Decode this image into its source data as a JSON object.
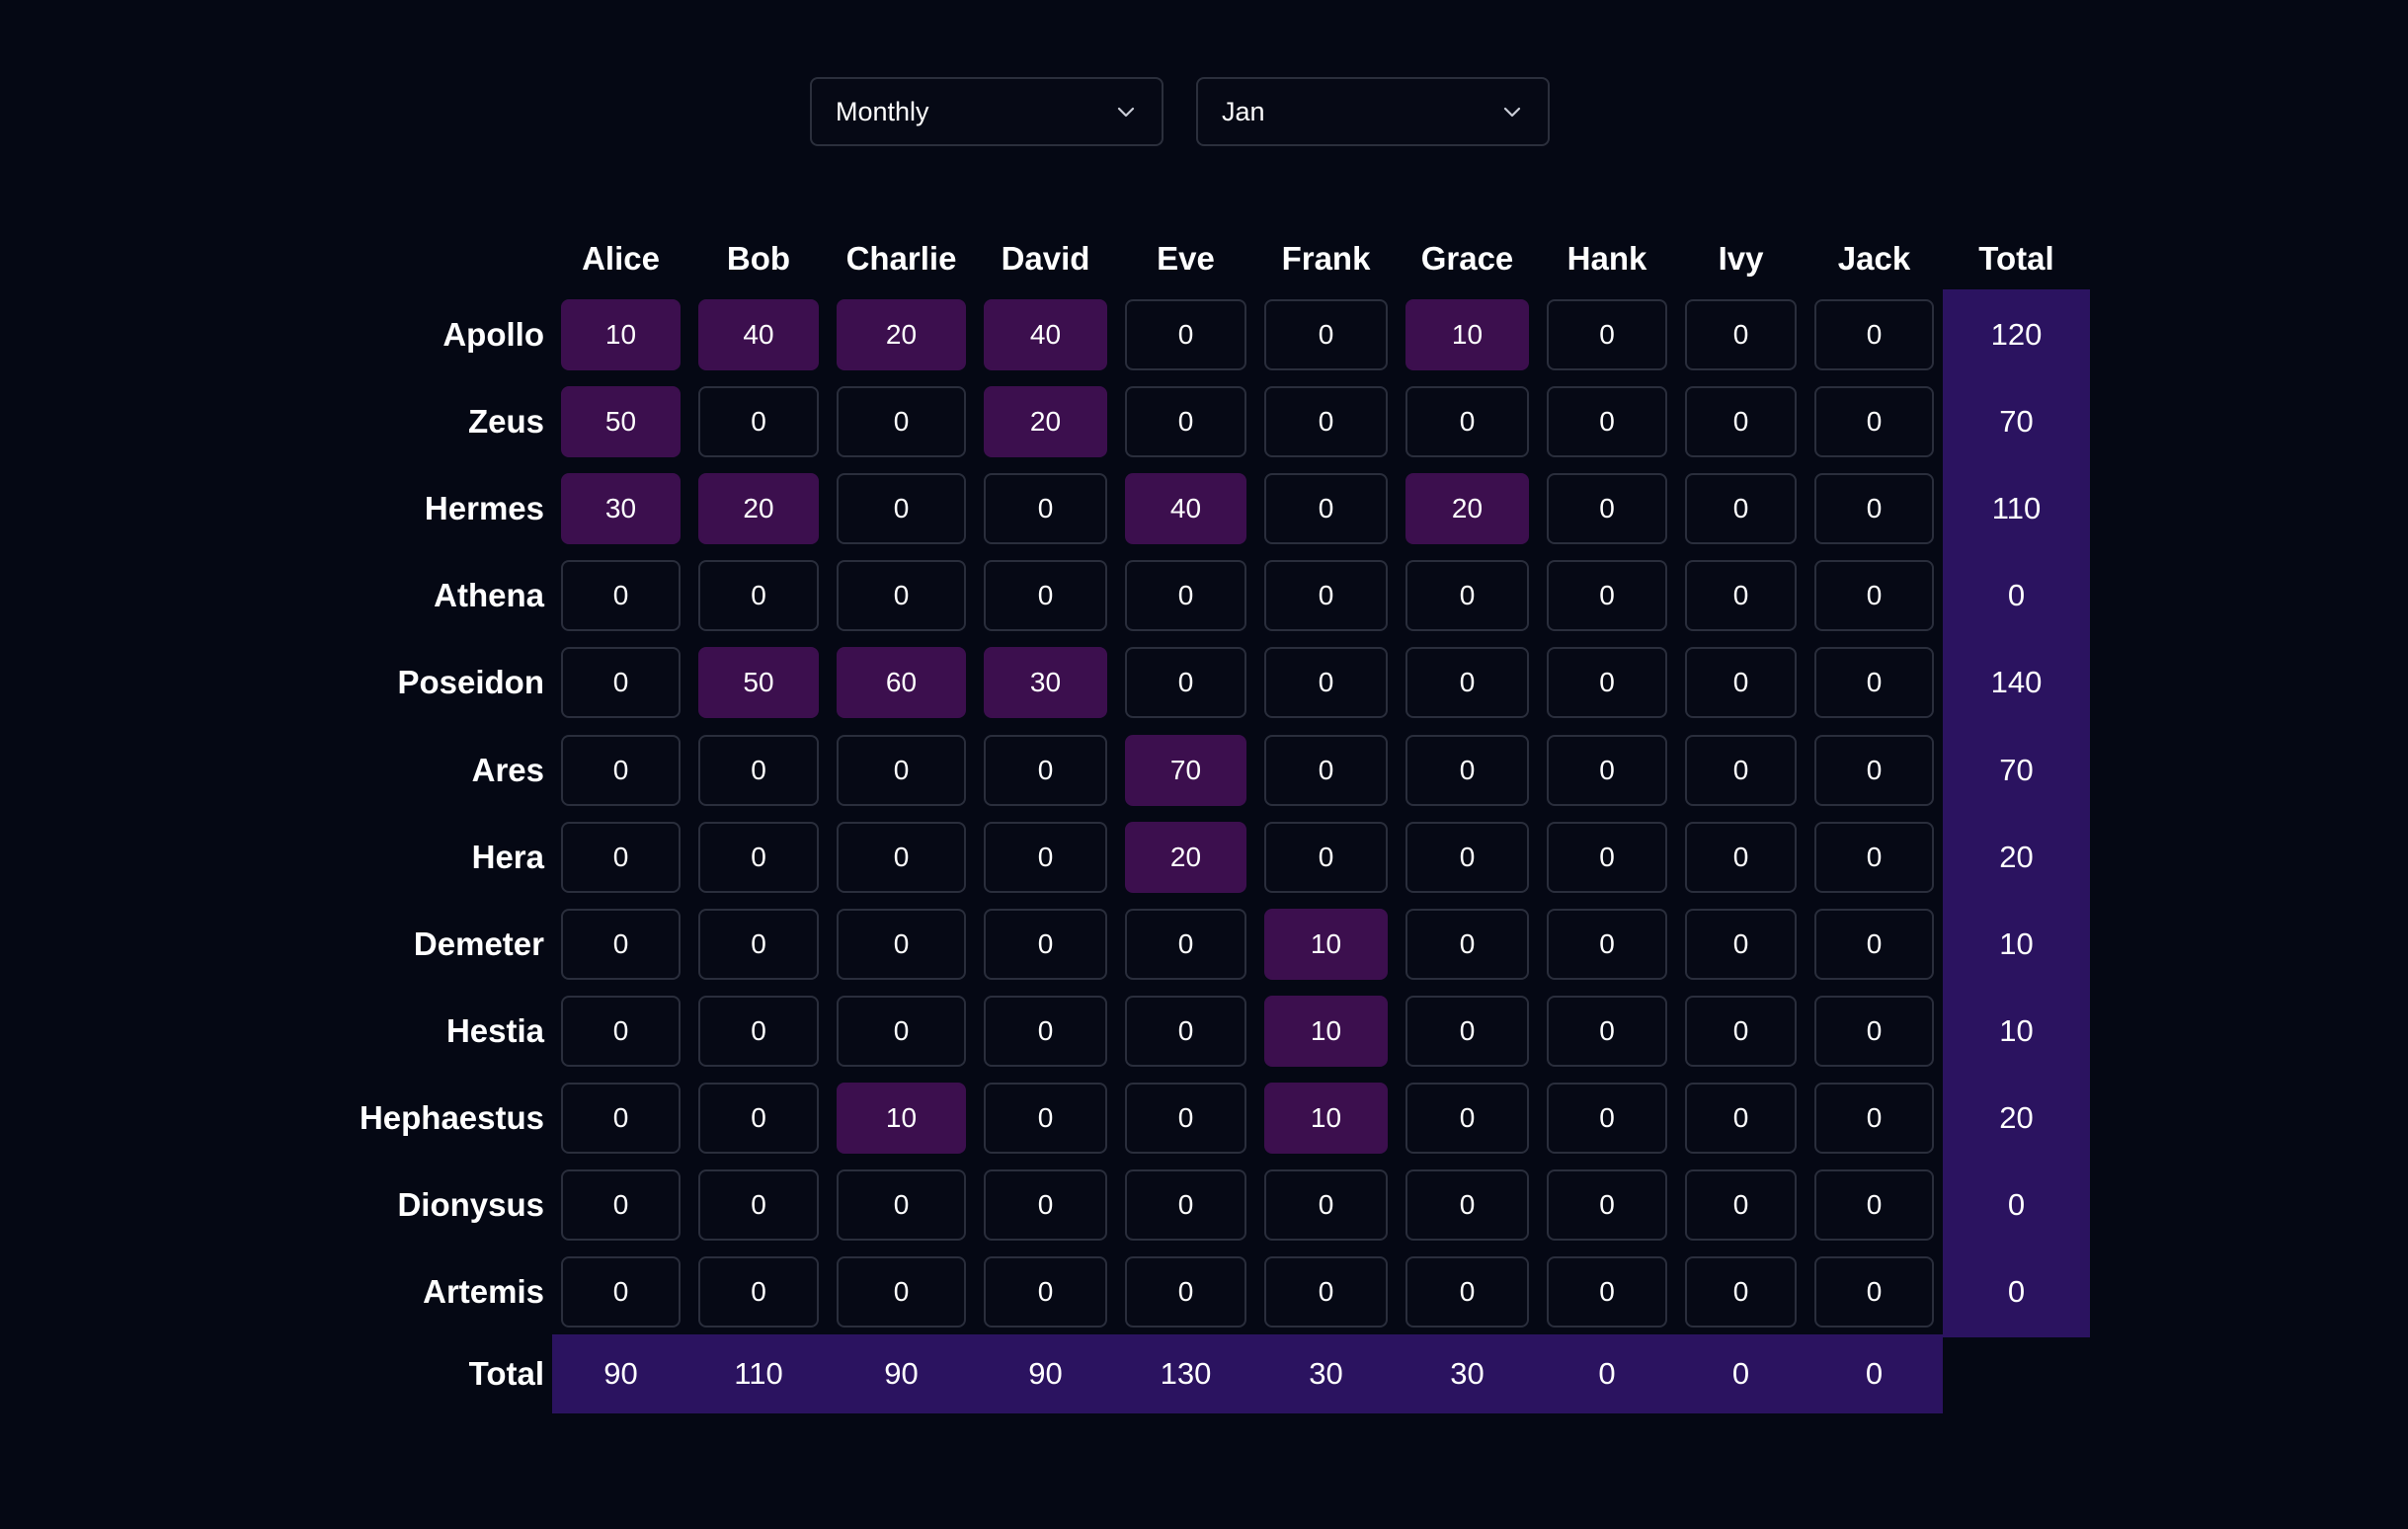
{
  "controls": {
    "period": {
      "selected": "Monthly"
    },
    "month": {
      "selected": "Jan"
    }
  },
  "colors": {
    "background": "#050814",
    "cell_border": "#2a2e3c",
    "highlight_cell": "#3c0f4e",
    "total_band": "#2b1360"
  },
  "columns": [
    "Alice",
    "Bob",
    "Charlie",
    "David",
    "Eve",
    "Frank",
    "Grace",
    "Hank",
    "Ivy",
    "Jack"
  ],
  "total_label": "Total",
  "rows": [
    {
      "name": "Apollo",
      "values": [
        10,
        40,
        20,
        40,
        0,
        0,
        10,
        0,
        0,
        0
      ],
      "total": 120
    },
    {
      "name": "Zeus",
      "values": [
        50,
        0,
        0,
        20,
        0,
        0,
        0,
        0,
        0,
        0
      ],
      "total": 70
    },
    {
      "name": "Hermes",
      "values": [
        30,
        20,
        0,
        0,
        40,
        0,
        20,
        0,
        0,
        0
      ],
      "total": 110
    },
    {
      "name": "Athena",
      "values": [
        0,
        0,
        0,
        0,
        0,
        0,
        0,
        0,
        0,
        0
      ],
      "total": 0
    },
    {
      "name": "Poseidon",
      "values": [
        0,
        50,
        60,
        30,
        0,
        0,
        0,
        0,
        0,
        0
      ],
      "total": 140
    },
    {
      "name": "Ares",
      "values": [
        0,
        0,
        0,
        0,
        70,
        0,
        0,
        0,
        0,
        0
      ],
      "total": 70
    },
    {
      "name": "Hera",
      "values": [
        0,
        0,
        0,
        0,
        20,
        0,
        0,
        0,
        0,
        0
      ],
      "total": 20
    },
    {
      "name": "Demeter",
      "values": [
        0,
        0,
        0,
        0,
        0,
        10,
        0,
        0,
        0,
        0
      ],
      "total": 10
    },
    {
      "name": "Hestia",
      "values": [
        0,
        0,
        0,
        0,
        0,
        10,
        0,
        0,
        0,
        0
      ],
      "total": 10
    },
    {
      "name": "Hephaestus",
      "values": [
        0,
        0,
        10,
        0,
        0,
        10,
        0,
        0,
        0,
        0
      ],
      "total": 20
    },
    {
      "name": "Dionysus",
      "values": [
        0,
        0,
        0,
        0,
        0,
        0,
        0,
        0,
        0,
        0
      ],
      "total": 0
    },
    {
      "name": "Artemis",
      "values": [
        0,
        0,
        0,
        0,
        0,
        0,
        0,
        0,
        0,
        0
      ],
      "total": 0
    }
  ],
  "column_totals": [
    90,
    110,
    90,
    90,
    130,
    30,
    30,
    0,
    0,
    0
  ]
}
